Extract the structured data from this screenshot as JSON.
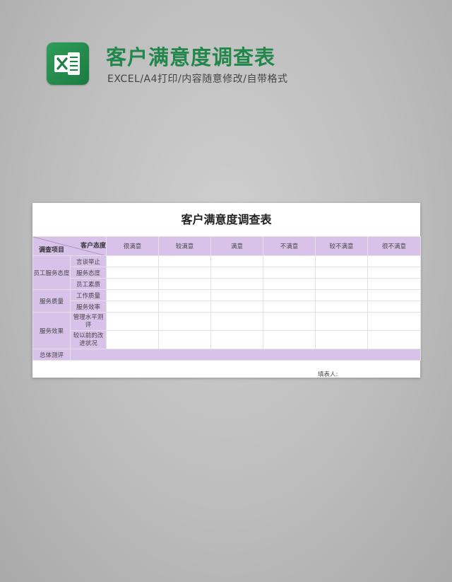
{
  "header": {
    "logo_icon": "excel-icon",
    "title": "客户满意度调查表",
    "subtitle": "EXCEL/A4打印/内容随意修改/自带格式"
  },
  "sheet": {
    "title": "客户满意度调查表",
    "corner_top": "客户态度",
    "corner_bottom": "调查项目",
    "columns": [
      "很满意",
      "较满意",
      "满意",
      "不满意",
      "较不满意",
      "很不满意"
    ],
    "groups": [
      {
        "label": "员工服务态度",
        "items": [
          "言谈举止",
          "服务态度",
          "员工素质"
        ]
      },
      {
        "label": "服务质量",
        "items": [
          "工作质量",
          "服务效率"
        ]
      },
      {
        "label": "服务效果",
        "items": [
          "管理水平测评",
          "较以前的改进状况"
        ]
      }
    ],
    "total_label": "总体测评",
    "footer_label": "填表人:"
  },
  "colors": {
    "accent_green": "#22874a",
    "lavender": "#d8c2ea"
  }
}
